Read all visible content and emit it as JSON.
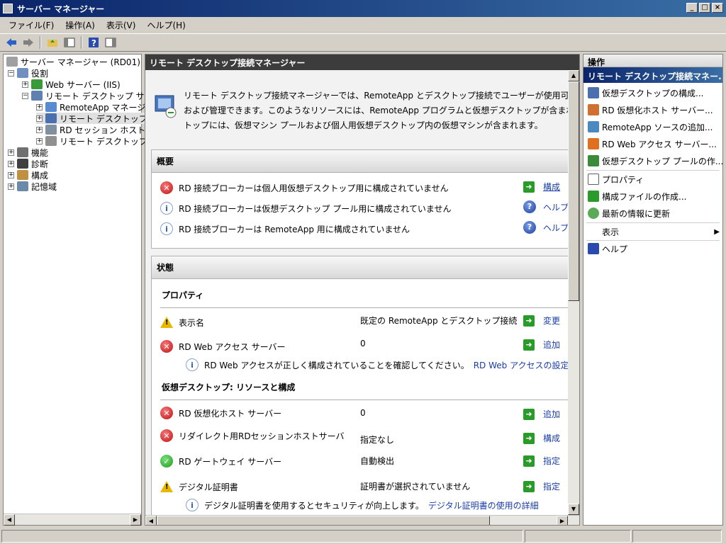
{
  "window": {
    "title": "サーバー マネージャー",
    "min": "_",
    "max": "□",
    "close": "×"
  },
  "menu": [
    "ファイル(F)",
    "操作(A)",
    "表示(V)",
    "ヘルプ(H)"
  ],
  "tree": [
    {
      "label": "サーバー マネージャー (RD01)",
      "exp": ""
    },
    {
      "label": "役割",
      "exp": "−"
    },
    {
      "label": "Web サーバー (IIS)",
      "exp": "+"
    },
    {
      "label": "リモート デスクトップ サービス",
      "exp": "−"
    },
    {
      "label": "RemoteApp マネージャー",
      "exp": "+"
    },
    {
      "label": "リモート デスクトップ接続マネージャー",
      "exp": "+"
    },
    {
      "label": "RD セッション ホストの構成",
      "exp": "+"
    },
    {
      "label": "リモート デスクトップ サービス マネージャー",
      "exp": "+"
    },
    {
      "label": "機能",
      "exp": "+"
    },
    {
      "label": "診断",
      "exp": "+"
    },
    {
      "label": "構成",
      "exp": "+"
    },
    {
      "label": "記憶域",
      "exp": "+"
    }
  ],
  "main": {
    "header": "リモート デスクトップ接続マネージャー",
    "intro": [
      "リモート デスクトップ接続マネージャーでは、RemoteApp とデスクトップ接続でユーザーが使用可",
      "および管理できます。このようなリソースには、RemoteApp プログラムと仮想デスクトップが含まれ",
      "トップには、仮想マシン プールおよび個人用仮想デスクトップ内の仮想マシンが含まれます。"
    ],
    "overview": {
      "title": "概要",
      "rows": [
        {
          "text": "RD 接続ブローカーは個人用仮想デスクトップ用に構成されていません",
          "action": "構成"
        },
        {
          "text": "RD 接続ブローカーは仮想デスクトップ プール用に構成されていません",
          "action": "ヘルプ"
        },
        {
          "text": "RD 接続ブローカーは RemoteApp 用に構成されていません",
          "action": "ヘルプ"
        }
      ]
    },
    "status": {
      "title": "状態",
      "properties_title": "プロパティ",
      "props": [
        {
          "name": "表示名",
          "value": "既定の RemoteApp とデスクトップ接続",
          "action": "変更"
        },
        {
          "name": "RD Web アクセス サーバー",
          "value": "0",
          "action": "追加"
        }
      ],
      "note": "RD Web アクセスが正しく構成されていることを確認してください。",
      "note_link": "RD Web アクセスの設定",
      "vd_title": "仮想デスクトップ: リソースと構成",
      "vd": [
        {
          "name": "RD 仮想化ホスト サーバー",
          "value": "0",
          "action": "追加"
        },
        {
          "name": "リダイレクト用RDセッションホストサーバ",
          "value": "指定なし",
          "action": "構成"
        },
        {
          "name": "RD ゲートウェイ サーバー",
          "value": "自動検出",
          "action": "指定"
        },
        {
          "name": "デジタル証明書",
          "value": "証明書が選択されていません",
          "action": "指定"
        }
      ],
      "cut_text": "デジタル証明書を使用するとセキュリティが向上します。",
      "cut_link": "デジタル証明書の使用の詳細"
    }
  },
  "actions": {
    "title": "操作",
    "section": "リモート デスクトップ接続マネー...",
    "items": [
      "仮想デスクトップの構成...",
      "RD 仮想化ホスト サーバー...",
      "RemoteApp ソースの追加...",
      "RD Web アクセス サーバー...",
      "仮想デスクトップ プールの作..."
    ],
    "items2": [
      "プロパティ",
      "構成ファイルの作成...",
      "最新の情報に更新"
    ],
    "view": "表示",
    "help": "ヘルプ"
  }
}
